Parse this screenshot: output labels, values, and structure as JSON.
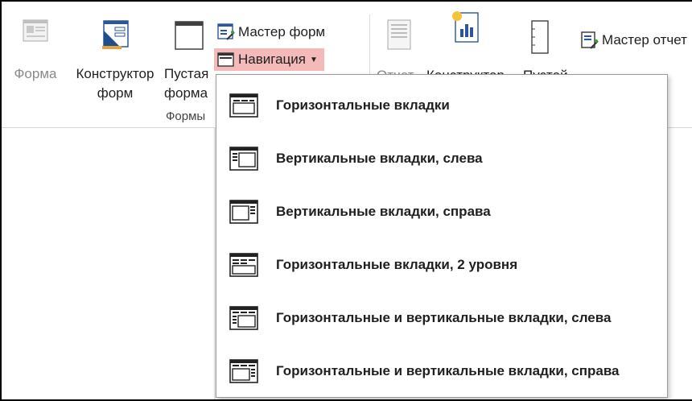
{
  "ribbon": {
    "forms_group": {
      "form_button": "Форма",
      "form_design_button_line1": "Конструктор",
      "form_design_button_line2": "форм",
      "blank_form_line1": "Пустая",
      "blank_form_line2": "форма",
      "form_wizard": "Мастер форм",
      "navigation": "Навигация",
      "group_label": "Формы"
    },
    "reports_group": {
      "report_label_partial": "Отчет",
      "report_design_partial": "Конструктор",
      "blank_report_partial": "Пустой",
      "report_wizard": "Мастер отчет"
    }
  },
  "navigation_menu": {
    "items": [
      {
        "label": "Горизонтальные вкладки",
        "icon": "horizontal-tabs-icon"
      },
      {
        "label": "Вертикальные вкладки, слева",
        "icon": "vertical-tabs-left-icon"
      },
      {
        "label": "Вертикальные вкладки, справа",
        "icon": "vertical-tabs-right-icon"
      },
      {
        "label": "Горизонтальные вкладки, 2 уровня",
        "icon": "horizontal-tabs-2-levels-icon"
      },
      {
        "label": "Горизонтальные и вертикальные вкладки, слева",
        "icon": "horizontal-vertical-tabs-left-icon"
      },
      {
        "label": "Горизонтальные и вертикальные вкладки, справа",
        "icon": "horizontal-vertical-tabs-right-icon"
      }
    ]
  },
  "colors": {
    "accent_nav": "#f4b9b9",
    "menu_border": "#9a9a9a"
  }
}
